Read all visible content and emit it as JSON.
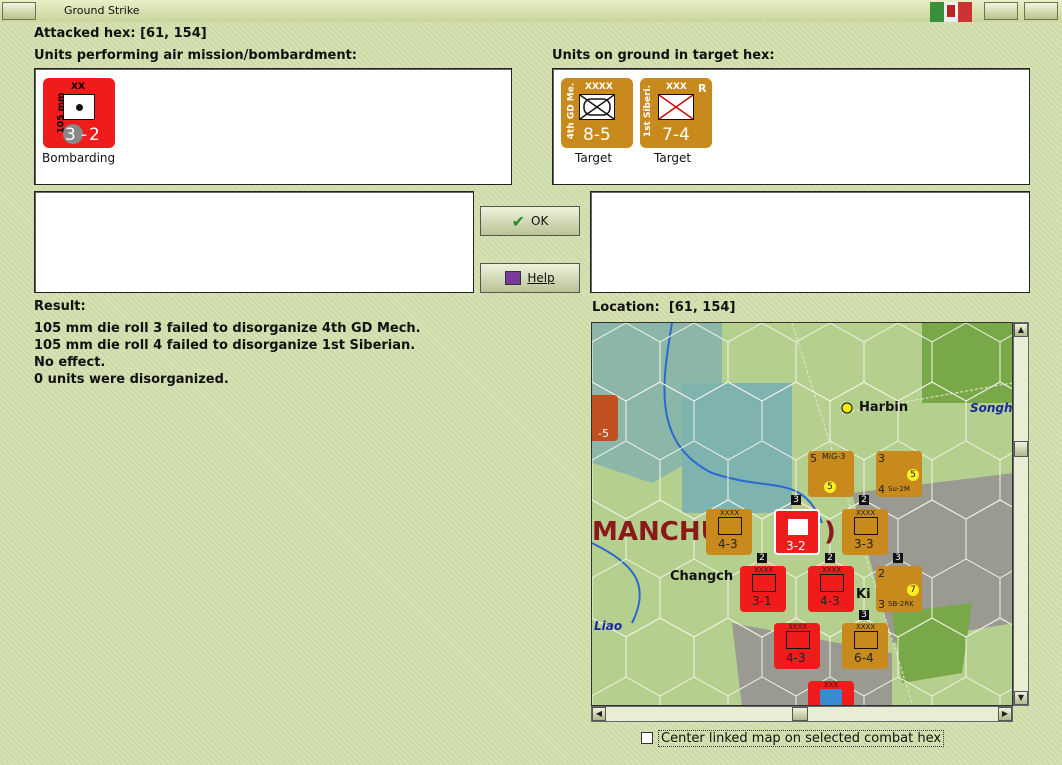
{
  "window": {
    "title": "Ground Strike"
  },
  "attacked_hex": {
    "label": "Attacked hex:",
    "value": "[61, 154]"
  },
  "air_units": {
    "heading": "Units performing air mission/bombardment:",
    "items": [
      {
        "top_mark": "XX",
        "side_text": "105 mm",
        "attack": "3",
        "defense": "2",
        "caption": "Bombarding",
        "color": "#f01c1c"
      }
    ]
  },
  "ground_units": {
    "heading": "Units on ground in target hex:",
    "items": [
      {
        "top_mark": "XXXX",
        "side_text": "4th GD Me.",
        "values": "8-5",
        "caption": "Target",
        "corner": "",
        "color": "#c88a1c"
      },
      {
        "top_mark": "XXX",
        "side_text": "1st Siberi.",
        "values": "7-4",
        "caption": "Target",
        "corner": "R",
        "color": "#c88a1c"
      }
    ]
  },
  "buttons": {
    "ok": "OK",
    "help": "Help"
  },
  "result": {
    "label": "Result:",
    "lines": [
      "105 mm die roll 3 failed to disorganize 4th GD Mech.",
      "105 mm die roll 4 failed to disorganize 1st Siberian.",
      "No effect.",
      "0 units were disorganized."
    ]
  },
  "location": {
    "label": "Location:",
    "value": "[61, 154]"
  },
  "map": {
    "labels": {
      "region": "MANCHU",
      "region_tail": ")",
      "city1": "Harbin",
      "city2": "Changch",
      "city3": "Ki",
      "river1": "Songh",
      "river2": "Liao"
    },
    "counters": [
      {
        "id": "mig3",
        "top": "5",
        "name": "MiG-3",
        "val": "5",
        "color": "#c88a1c"
      },
      {
        "id": "su2m",
        "top": "3",
        "name": "Su-2M",
        "val": "5",
        "bottom": "4",
        "color": "#c88a1c"
      },
      {
        "id": "c1",
        "top": "XXXX",
        "val": "4-3",
        "color": "#c88a1c"
      },
      {
        "id": "c2",
        "top": "",
        "val": "3-2",
        "color": "#f01c1c"
      },
      {
        "id": "c3",
        "top": "XXXX",
        "val": "3-3",
        "color": "#c88a1c"
      },
      {
        "id": "c4",
        "top": "XXXX",
        "val": "3-1",
        "color": "#f01c1c"
      },
      {
        "id": "c5",
        "top": "XXXX",
        "val": "4-3",
        "color": "#f01c1c"
      },
      {
        "id": "sb2rk",
        "top": "2",
        "name": "SB-2RK",
        "val": "7",
        "bottom": "3",
        "color": "#c88a1c"
      },
      {
        "id": "c6",
        "top": "XXXX",
        "val": "4-3",
        "color": "#f01c1c"
      },
      {
        "id": "c7",
        "top": "XXXX",
        "val": "6-4",
        "color": "#c88a1c"
      },
      {
        "id": "c8",
        "top": "XXX",
        "val": "",
        "color": "#f01c1c"
      },
      {
        "id": "left",
        "top": "XX",
        "val": "-5",
        "color": "#c05020"
      }
    ],
    "stack_badges": [
      "3",
      "2",
      "2",
      "2",
      "3",
      "3"
    ]
  },
  "center_option": {
    "label": "Center linked map on selected combat hex",
    "checked": false
  }
}
